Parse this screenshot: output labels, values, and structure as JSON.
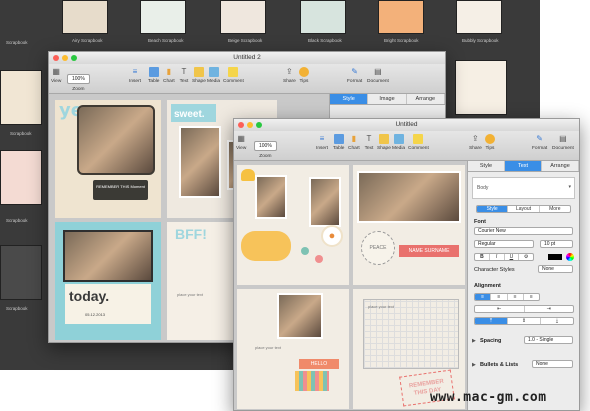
{
  "chooser": {
    "templates": [
      {
        "label": "Airy Scrapbook"
      },
      {
        "label": "Beach Scrapbook"
      },
      {
        "label": "Beige Scrapbook"
      },
      {
        "label": "Black Scrapbook"
      },
      {
        "label": "Bright Scrapbook"
      },
      {
        "label": "Bubbly Scrapbook"
      }
    ],
    "left_labels": [
      "Scrapbook",
      "Scrapbook",
      "Scrapbook",
      "Scrapbook",
      "Scrapbook"
    ]
  },
  "window1": {
    "title": "Untitled 2",
    "zoom_value": "100%",
    "toolbar": {
      "view": "View",
      "zoom": "Zoom",
      "insert": "Insert",
      "table": "Table",
      "chart": "Chart",
      "text": "Text",
      "shape": "Shape",
      "media": "Media",
      "comment": "Comment",
      "share": "Share",
      "tips": "Tips",
      "format": "Format",
      "document": "Document"
    },
    "inspector_tabs": [
      "Style",
      "Image",
      "Arrange"
    ],
    "page_text": {
      "yes": "yes",
      "sweet": "sweet.",
      "bff": "BFF!",
      "today": "today.",
      "remember": "REMEMBER THIS Moment",
      "date": "05.12.2013",
      "placeholder": "place your text"
    }
  },
  "window2": {
    "title": "Untitled",
    "zoom_value": "100%",
    "toolbar": {
      "view": "View",
      "zoom": "Zoom",
      "insert": "Insert",
      "table": "Table",
      "chart": "Chart",
      "text": "Text",
      "shape": "Shape",
      "media": "Media",
      "comment": "Comment",
      "share": "Share",
      "tips": "Tips",
      "format": "Format",
      "document": "Document"
    },
    "inspector_tabs": [
      "Style",
      "Text",
      "Arrange"
    ],
    "paragraph_style": "Body",
    "sub_tabs": [
      "Style",
      "Layout",
      "More"
    ],
    "font_section": "Font",
    "font_name": "Courier New",
    "font_weight": "Regular",
    "font_size": "10 pt",
    "char_styles_label": "Character Styles",
    "char_styles_value": "None",
    "alignment_section": "Alignment",
    "spacing_label": "Spacing",
    "spacing_value": "1.0 - Single",
    "bullets_label": "Bullets & Lists",
    "bullets_value": "None",
    "page_text": {
      "peace": "PEACE",
      "name_surname": "NAME SURNAME",
      "hello": "HELLO",
      "remember": "REMEMBER THIS DAY",
      "placeholder": "place your text"
    }
  },
  "watermark": "www.mac-gm.com"
}
